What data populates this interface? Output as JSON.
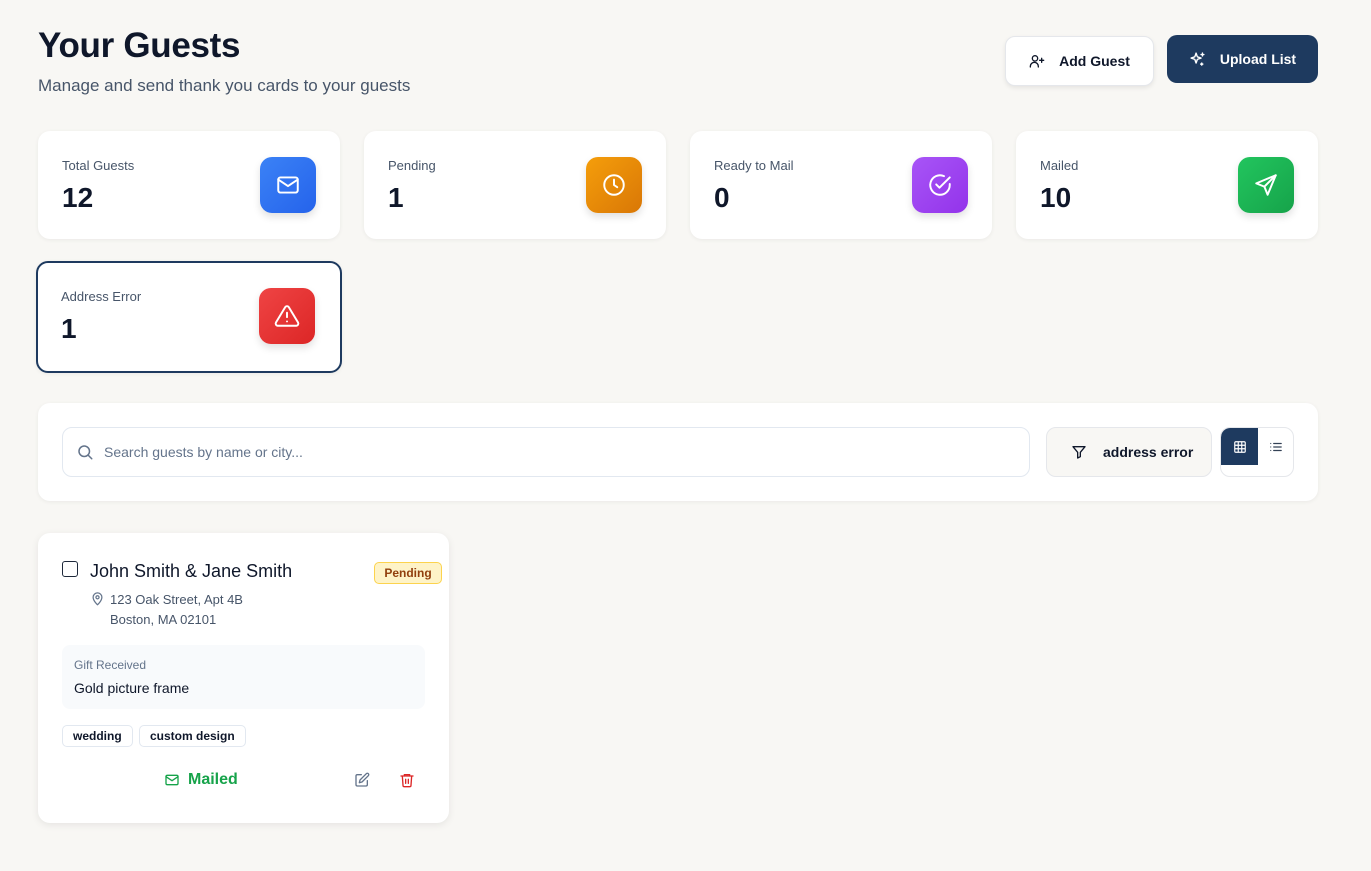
{
  "header": {
    "title": "Your Guests",
    "subtitle": "Manage and send thank you cards to your guests",
    "add_guest_label": "Add Guest",
    "upload_list_label": "Upload List"
  },
  "stats": [
    {
      "label": "Total Guests",
      "value": "12",
      "icon": "mail-icon",
      "color": "#3b82f6"
    },
    {
      "label": "Pending",
      "value": "1",
      "icon": "clock-icon",
      "color": "#f59e0b"
    },
    {
      "label": "Ready to Mail",
      "value": "0",
      "icon": "check-circle-icon",
      "color": "#a855f7"
    },
    {
      "label": "Mailed",
      "value": "10",
      "icon": "send-icon",
      "color": "#22c55e"
    },
    {
      "label": "Address Error",
      "value": "1",
      "icon": "alert-triangle-icon",
      "color": "#ef4444"
    }
  ],
  "toolbar": {
    "search_placeholder": "Search guests by name or city...",
    "search_value": "",
    "filter_label": "address error",
    "view_mode": "grid"
  },
  "guests": [
    {
      "name": "John Smith & Jane Smith",
      "status": "Pending",
      "address_line1": "123 Oak Street, Apt 4B",
      "address_line2": "Boston, MA 02101",
      "gift_label": "Gift Received",
      "gift": "Gold picture frame",
      "tags": [
        "wedding",
        "custom design"
      ],
      "mail_status": "Mailed"
    }
  ],
  "colors": {
    "primary": "#1e3a5f",
    "background": "#f8f7f4",
    "mailed_green": "#16a34a",
    "pending_badge_bg": "#fef3c7",
    "delete_red": "#dc2626"
  }
}
